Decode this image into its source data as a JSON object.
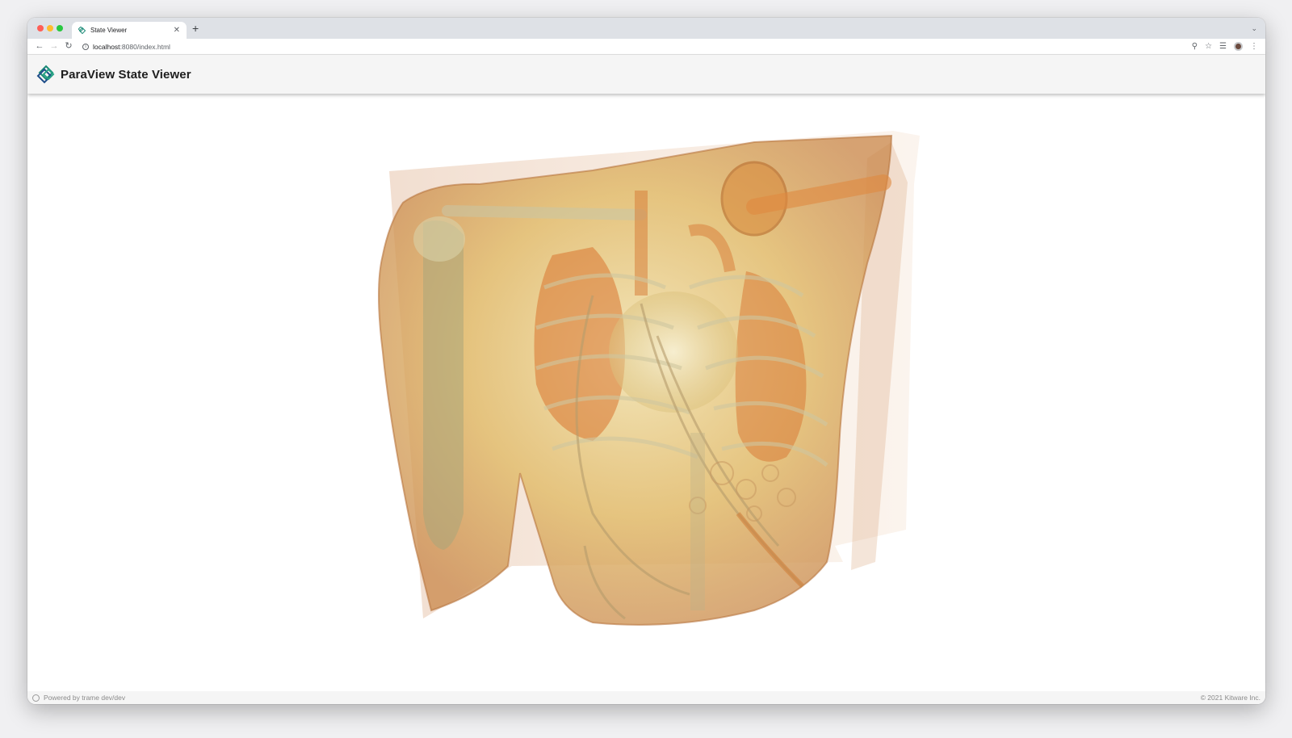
{
  "browser": {
    "tab_title": "State Viewer",
    "tab_close": "✕",
    "new_tab": "+",
    "tab_menu": "⌄",
    "url_host": "localhost",
    "url_path": ":8080/index.html",
    "icons": {
      "back": "←",
      "forward": "→",
      "reload": "↻",
      "zoom": "⚲",
      "bookmark": "☆",
      "reading_list": "☰",
      "menu": "⋮"
    }
  },
  "app": {
    "title": "ParaView State Viewer",
    "brand_color": "#1a8a76"
  },
  "viewport": {
    "content": "volume rendering of human torso CT (ribs, shoulder bones, vessels)",
    "tint": "#d9a350"
  },
  "footer": {
    "powered_by": "Powered by trame dev/dev",
    "copyright": "© 2021 Kitware Inc."
  }
}
